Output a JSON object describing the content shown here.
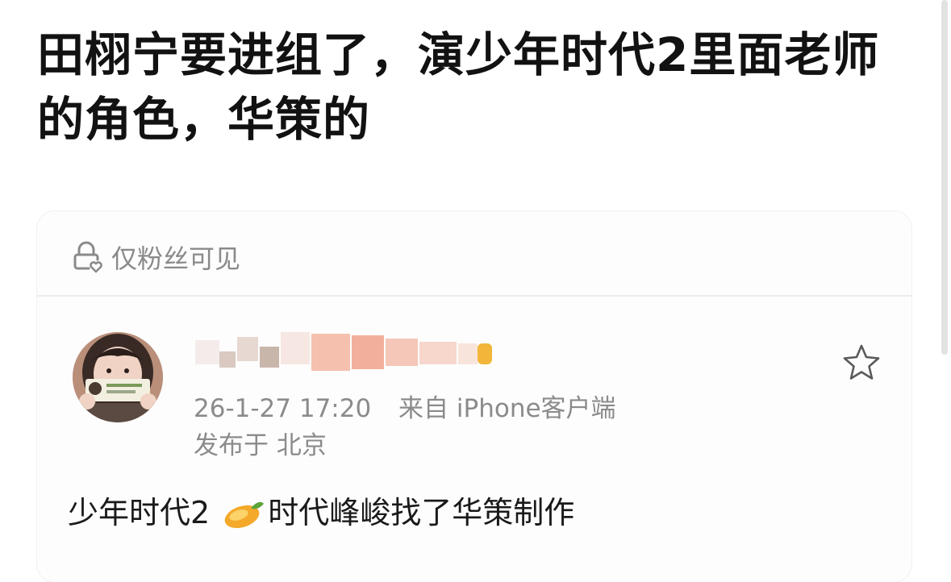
{
  "post": {
    "title": "田栩宁要进组了，演少年时代2里面老师的角色，华策的"
  },
  "card": {
    "visibility_label": "仅粉丝可见",
    "author": {
      "timestamp": "26-1-27 17:20",
      "source": "来自 iPhone客户端",
      "location": "发布于 北京"
    },
    "content": {
      "before_emoji": "少年时代2",
      "emoji": "mango-emoji",
      "after_emoji": "时代峰峻找了华策制作"
    }
  },
  "icons": {
    "visibility": "lock-heart-icon",
    "favorite": "star-icon"
  },
  "colors": {
    "title": "#121212",
    "meta": "#8b8b8b",
    "divider": "#ececec",
    "username_blur": "#f0a890",
    "username_badge": "#f2b63a"
  }
}
